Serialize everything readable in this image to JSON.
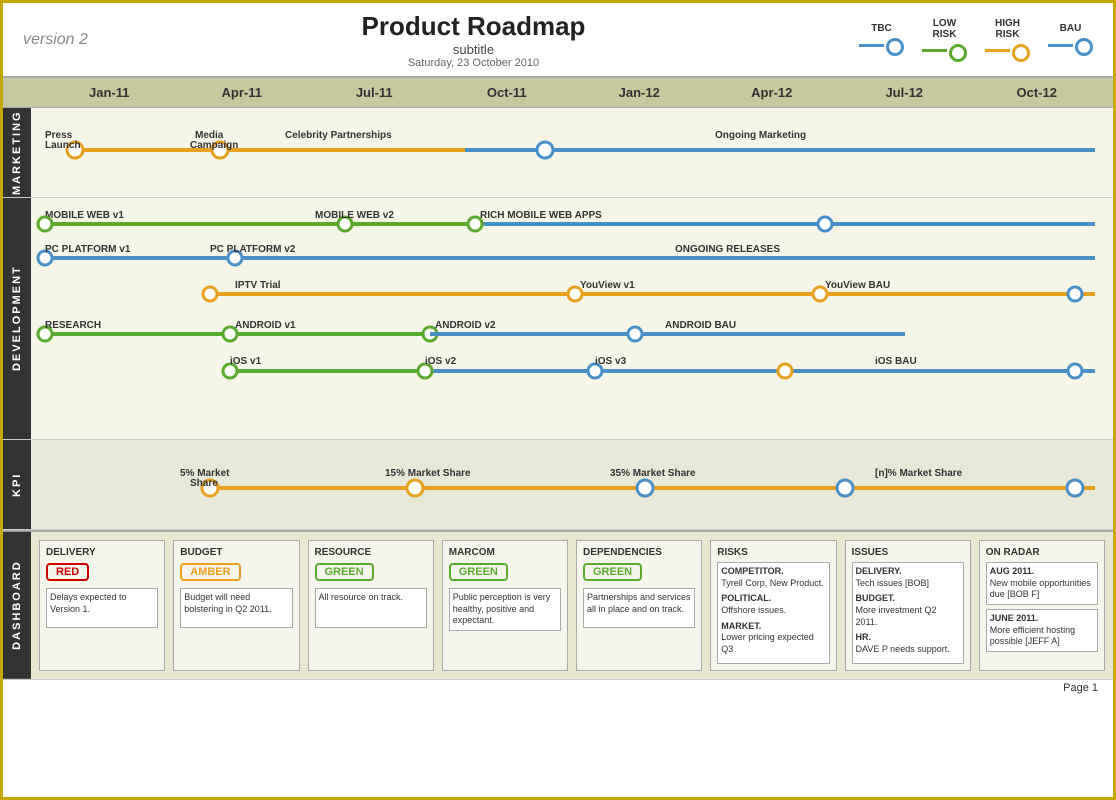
{
  "header": {
    "version": "version 2",
    "title": "Product Roadmap",
    "subtitle": "subtitle",
    "date": "Saturday, 23 October 2010",
    "legend": [
      {
        "label": "TBC",
        "color": "#4a90c8"
      },
      {
        "label": "LOW\nRISK",
        "color": "#5aaa30"
      },
      {
        "label": "HIGH\nRISK",
        "color": "#e8a020"
      },
      {
        "label": "BAU",
        "color": "#4a90c8"
      }
    ]
  },
  "timeline": {
    "months": [
      "Jan-11",
      "Apr-11",
      "Jul-11",
      "Oct-11",
      "Jan-12",
      "Apr-12",
      "Jul-12",
      "Oct-12"
    ]
  },
  "sections": {
    "marketing": {
      "label": "MARKETING",
      "tracks": [
        {
          "label": "Press Launch",
          "label2": "Media Campaign",
          "label3": "Celebrity Partnerships",
          "label4": "Ongoing Marketing"
        }
      ]
    },
    "development": {
      "label": "DEVELOPMENT",
      "tracks": [
        {
          "name": "MOBILE WEB v1 → MOBILE WEB v2 → RICH MOBILE WEB APPS"
        },
        {
          "name": "PC PLATFORM v1 → PC PLATFORM v2 → ONGOING RELEASES"
        },
        {
          "name": "IPTV Trial → YouView v1 → YouView BAU"
        },
        {
          "name": "RESEARCH → ANDROID v1 → ANDROID v2 → ANDROID BAU"
        },
        {
          "name": "iOS v1 → iOS v2 → iOS v3 → iOS BAU"
        }
      ]
    },
    "kpi": {
      "label": "KPI",
      "tracks": [
        {
          "name": "5% Market Share → 15% Market Share → 35% Market Share → [n]% Market Share"
        }
      ]
    }
  },
  "dashboard": {
    "label": "DASHBOARD",
    "cards": [
      {
        "title": "DELIVERY",
        "badge": "RED",
        "badge_type": "red",
        "text": "Delays expected to Version 1.",
        "has_box": true
      },
      {
        "title": "BUDGET",
        "badge": "AMBER",
        "badge_type": "amber",
        "text": "Budget will need bolstering in Q2 2011.",
        "has_box": true
      },
      {
        "title": "RESOURCE",
        "badge": "GREEN",
        "badge_type": "green",
        "text": "All resource on track.",
        "has_box": true
      },
      {
        "title": "MARCOM",
        "badge": "GREEN",
        "badge_type": "green",
        "text": "Public perception is very healthy, positive and expectant.",
        "has_box": true
      },
      {
        "title": "DEPENDENCIES",
        "badge": "GREEN",
        "badge_type": "green",
        "text": "Partnerships and services all in place and on track.",
        "has_box": true
      },
      {
        "title": "RISKS",
        "issues": [
          {
            "title": "COMPETITOR.",
            "text": "Tyrell Corp, New Product."
          },
          {
            "title": "POLITICAL.",
            "text": "Offshore issues."
          },
          {
            "title": "MARKET.",
            "text": "Lower pricing expected Q3"
          }
        ]
      },
      {
        "title": "ISSUES",
        "issues": [
          {
            "title": "DELIVERY.",
            "text": "Tech issues [BOB]"
          },
          {
            "title": "BUDGET.",
            "text": "More investment Q2 2011."
          },
          {
            "title": "HR.",
            "text": "DAVE P needs support."
          }
        ]
      },
      {
        "title": "ON RADAR",
        "issues": [
          {
            "title": "AUG 2011.",
            "text": "New mobile opportunities due [BOB F]"
          },
          {
            "title": "JUNE 2011.",
            "text": "More efficient hosting possible [JEFF A]"
          }
        ]
      }
    ]
  },
  "footer": {
    "page": "Page 1"
  }
}
